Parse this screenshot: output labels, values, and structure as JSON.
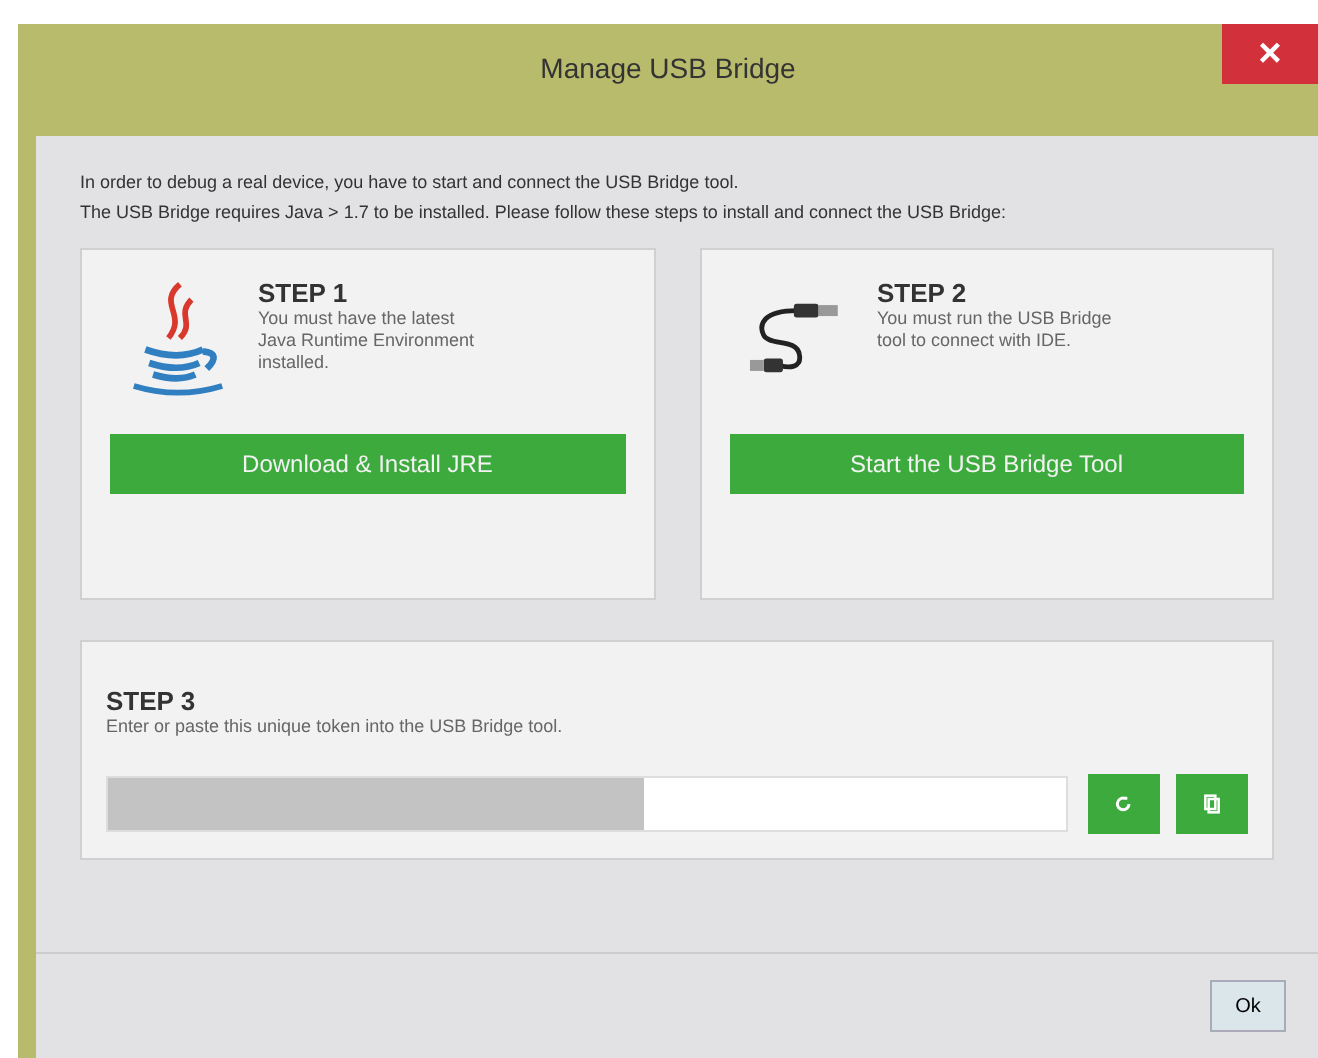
{
  "window": {
    "title": "Manage USB Bridge",
    "close": "×"
  },
  "intro": [
    "In order to debug a real device, you have to start and connect the USB Bridge tool.",
    "The USB Bridge requires Java > 1.7 to be installed. Please follow these steps to install and connect the USB Bridge:"
  ],
  "steps": [
    {
      "kind": "java",
      "title": "STEP 1",
      "text": "You must have the latest Java Runtime Environment installed.",
      "button": "Download & Install JRE"
    },
    {
      "kind": "usb",
      "title": "STEP 2",
      "text": "You must run the USB Bridge tool to connect with IDE.",
      "button": "Start the USB Bridge Tool"
    }
  ],
  "step3": {
    "title": "STEP 3",
    "text": "Enter or paste this unique token into the USB Bridge tool.",
    "token_progress": {
      "level": 0.56
    }
  },
  "footer": {
    "ok": "Ok"
  }
}
